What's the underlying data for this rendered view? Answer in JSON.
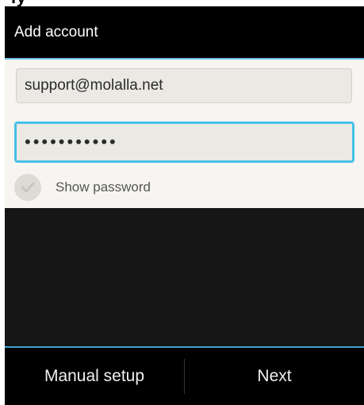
{
  "status_bar": {
    "clipped_text": "ly"
  },
  "action_bar": {
    "title": "Add account"
  },
  "form": {
    "email_value": "support@molalla.net",
    "password_masked": "•••••••••••",
    "show_password_label": "Show password",
    "show_password_checked": false
  },
  "buttons": {
    "manual_setup": "Manual setup",
    "next": "Next"
  },
  "colors": {
    "accent": "#45c0ea",
    "divider": "#6ec6e6",
    "form_background": "#f7f5f1",
    "bar_background": "#000000"
  },
  "icons": {
    "checkbox": "check-circle-icon"
  }
}
